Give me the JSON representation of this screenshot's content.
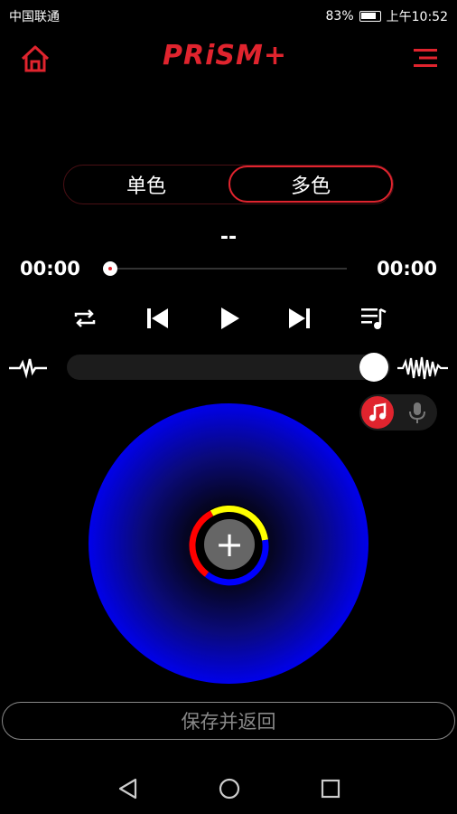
{
  "status_bar": {
    "carrier": "中国联通",
    "battery": "83%",
    "time": "上午10:52"
  },
  "header": {
    "logo": "PRiSM+",
    "home_icon": "home-icon",
    "menu_icon": "menu-icon"
  },
  "mode_tabs": {
    "single": "单色",
    "multi": "多色",
    "selected": "多色"
  },
  "player": {
    "track_name": "--",
    "elapsed": "00:00",
    "total": "00:00",
    "progress": 0,
    "sensitivity": 1.0
  },
  "source_toggle": {
    "selected": "music",
    "options": [
      "music-icon",
      "microphone-icon"
    ]
  },
  "color_ring": {
    "segments": [
      "#ffff00",
      "#0000ff",
      "#ff0000"
    ]
  },
  "actions": {
    "add": "+",
    "save": "保存并返回"
  },
  "colors": {
    "accent": "#e0242e",
    "wheel": "#0000ff"
  }
}
